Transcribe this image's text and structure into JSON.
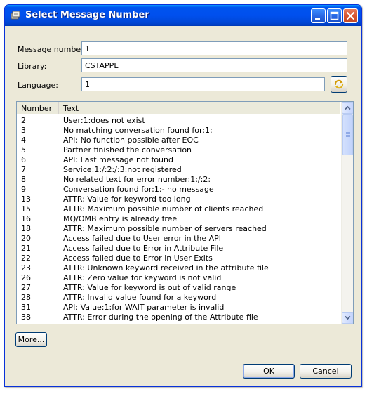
{
  "window": {
    "title": "Select Message Number",
    "controls": [
      "minimize",
      "maximize",
      "close"
    ]
  },
  "form": {
    "message_number_label": "Message number:",
    "message_number_value": "1",
    "library_label": "Library:",
    "library_value": "CSTAPPL",
    "language_label": "Language:",
    "language_value": "1",
    "language_button_icon": "swap-arrows-icon"
  },
  "table": {
    "columns": [
      "Number",
      "Text"
    ],
    "rows": [
      {
        "number": "2",
        "text": "User:1:does not exist"
      },
      {
        "number": "3",
        "text": "No matching conversation found for:1:"
      },
      {
        "number": "4",
        "text": "API: No function possible after EOC"
      },
      {
        "number": "5",
        "text": "Partner finished the conversation"
      },
      {
        "number": "6",
        "text": "API: Last message not found"
      },
      {
        "number": "7",
        "text": "Service:1:/:2:/:3:not registered"
      },
      {
        "number": "8",
        "text": "No related text for error number:1:/:2:"
      },
      {
        "number": "9",
        "text": "Conversation found for:1:- no message"
      },
      {
        "number": "13",
        "text": "ATTR: Value for keyword too long"
      },
      {
        "number": "15",
        "text": "ATTR: Maximum possible number of clients reached"
      },
      {
        "number": "16",
        "text": "MQ/OMB entry is already free"
      },
      {
        "number": "18",
        "text": "ATTR: Maximum possible number of servers reached"
      },
      {
        "number": "20",
        "text": "Access failed due to User error in the API"
      },
      {
        "number": "21",
        "text": "Access failed due to Error in Attribute File"
      },
      {
        "number": "22",
        "text": "Access failed due to Error in User Exits"
      },
      {
        "number": "23",
        "text": "ATTR: Unknown keyword received in the attribute file"
      },
      {
        "number": "26",
        "text": "ATTR: Zero value for keyword is not valid"
      },
      {
        "number": "27",
        "text": "ATTR: Value for keyword is out of valid range"
      },
      {
        "number": "28",
        "text": "ATTR: Invalid value found for a keyword"
      },
      {
        "number": "31",
        "text": "API: Value:1:for WAIT parameter is invalid"
      },
      {
        "number": "38",
        "text": "ATTR: Error during the opening of the Attribute file"
      }
    ]
  },
  "buttons": {
    "more": "More...",
    "ok": "OK",
    "cancel": "Cancel"
  }
}
